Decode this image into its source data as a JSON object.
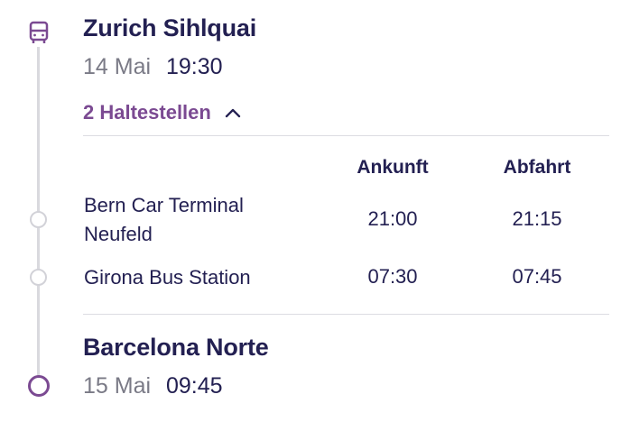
{
  "origin": {
    "name": "Zurich Sihlquai",
    "date": "14 Mai",
    "time": "19:30"
  },
  "stops_toggle": {
    "label": "2 Haltestellen",
    "icon": "chevron-up-icon"
  },
  "stops_table": {
    "headers": {
      "arrival": "Ankunft",
      "departure": "Abfahrt"
    },
    "rows": [
      {
        "name_line1": "Bern Car Terminal",
        "name_line2": "Neufeld",
        "arrival": "21:00",
        "departure": "21:15"
      },
      {
        "name_line1": "Girona Bus Station",
        "arrival": "07:30",
        "departure": "07:45"
      }
    ]
  },
  "destination": {
    "name": "Barcelona Norte",
    "date": "15 Mai",
    "time": "09:45"
  },
  "colors": {
    "accent": "#7b4a92",
    "text": "#232052",
    "muted": "#7a7a86",
    "line": "#d9d9de"
  }
}
